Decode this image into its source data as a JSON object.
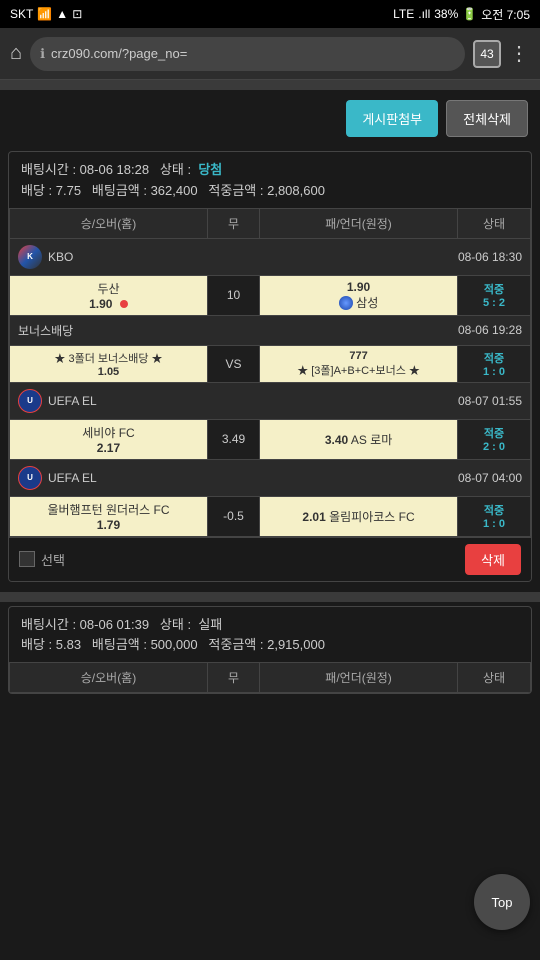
{
  "statusBar": {
    "carrier": "SKT",
    "signal_icons": "▲ !",
    "lte": "LTE",
    "battery": "38%",
    "time": "오전 7:05"
  },
  "browserBar": {
    "url": "crz090.com/?page_no=",
    "tabCount": "43"
  },
  "buttons": {
    "board": "게시판첨부",
    "deleteAll": "전체삭제"
  },
  "card1": {
    "bettingTime": "배팅시간 : 08-06 18:28",
    "statusLabel": "상태 :",
    "status": "당첨",
    "odds": "배당 : 7.75",
    "betAmount": "배팅금액 : 362,400",
    "hitAmount": "적중금액 : 2,808,600",
    "tableHeaders": [
      "승/오버(홈)",
      "무",
      "패/언더(원정)",
      "상태"
    ],
    "matches": [
      {
        "league": "KBO",
        "date": "08-06 18:30",
        "home": "두산",
        "homeOdds": "1.90",
        "draw": "10",
        "awayOdds": "1.90",
        "away": "삼성",
        "result": "적중",
        "score": "5 : 2",
        "hasRedDot": true,
        "hasBlueCircle": true
      }
    ],
    "bonusMatch": {
      "league": "보너스배당",
      "date": "08-06 19:28",
      "home": "★ 3폴더 보너스배당 ★",
      "homeOdds": "1.05",
      "draw": "VS",
      "awayOdds": "777",
      "away": "★ [3폴]A+B+C+보너스 ★",
      "result": "적중",
      "score": "1 : 0"
    },
    "uefaMatch1": {
      "league": "UEFA EL",
      "date": "08-07 01:55",
      "home": "세비야 FC",
      "homeOdds": "2.17",
      "draw": "3.49",
      "awayOdds": "3.40",
      "away": "AS 로마",
      "result": "적중",
      "score": "2 : 0"
    },
    "uefaMatch2": {
      "league": "UEFA EL",
      "date": "08-07 04:00",
      "home": "울버햄프턴 원더러스 FC",
      "homeOdds": "1.79",
      "draw": "-0.5",
      "awayOdds": "2.01",
      "away": "올림피아코스 FC",
      "result": "적중",
      "score": "1 : 0"
    },
    "checkboxLabel": "선택",
    "deleteBtn": "삭제"
  },
  "card2": {
    "bettingTime": "배팅시간 : 08-06 01:39",
    "statusLabel": "상태 :",
    "status": "실패",
    "odds": "배당 : 5.83",
    "betAmount": "배팅금액 : 500,000",
    "hitAmount": "적중금액 : 2,915,000",
    "tableHeaders": [
      "승/오버(홈)",
      "무",
      "패/언더(원정)",
      "상태"
    ]
  },
  "topButton": "Top"
}
